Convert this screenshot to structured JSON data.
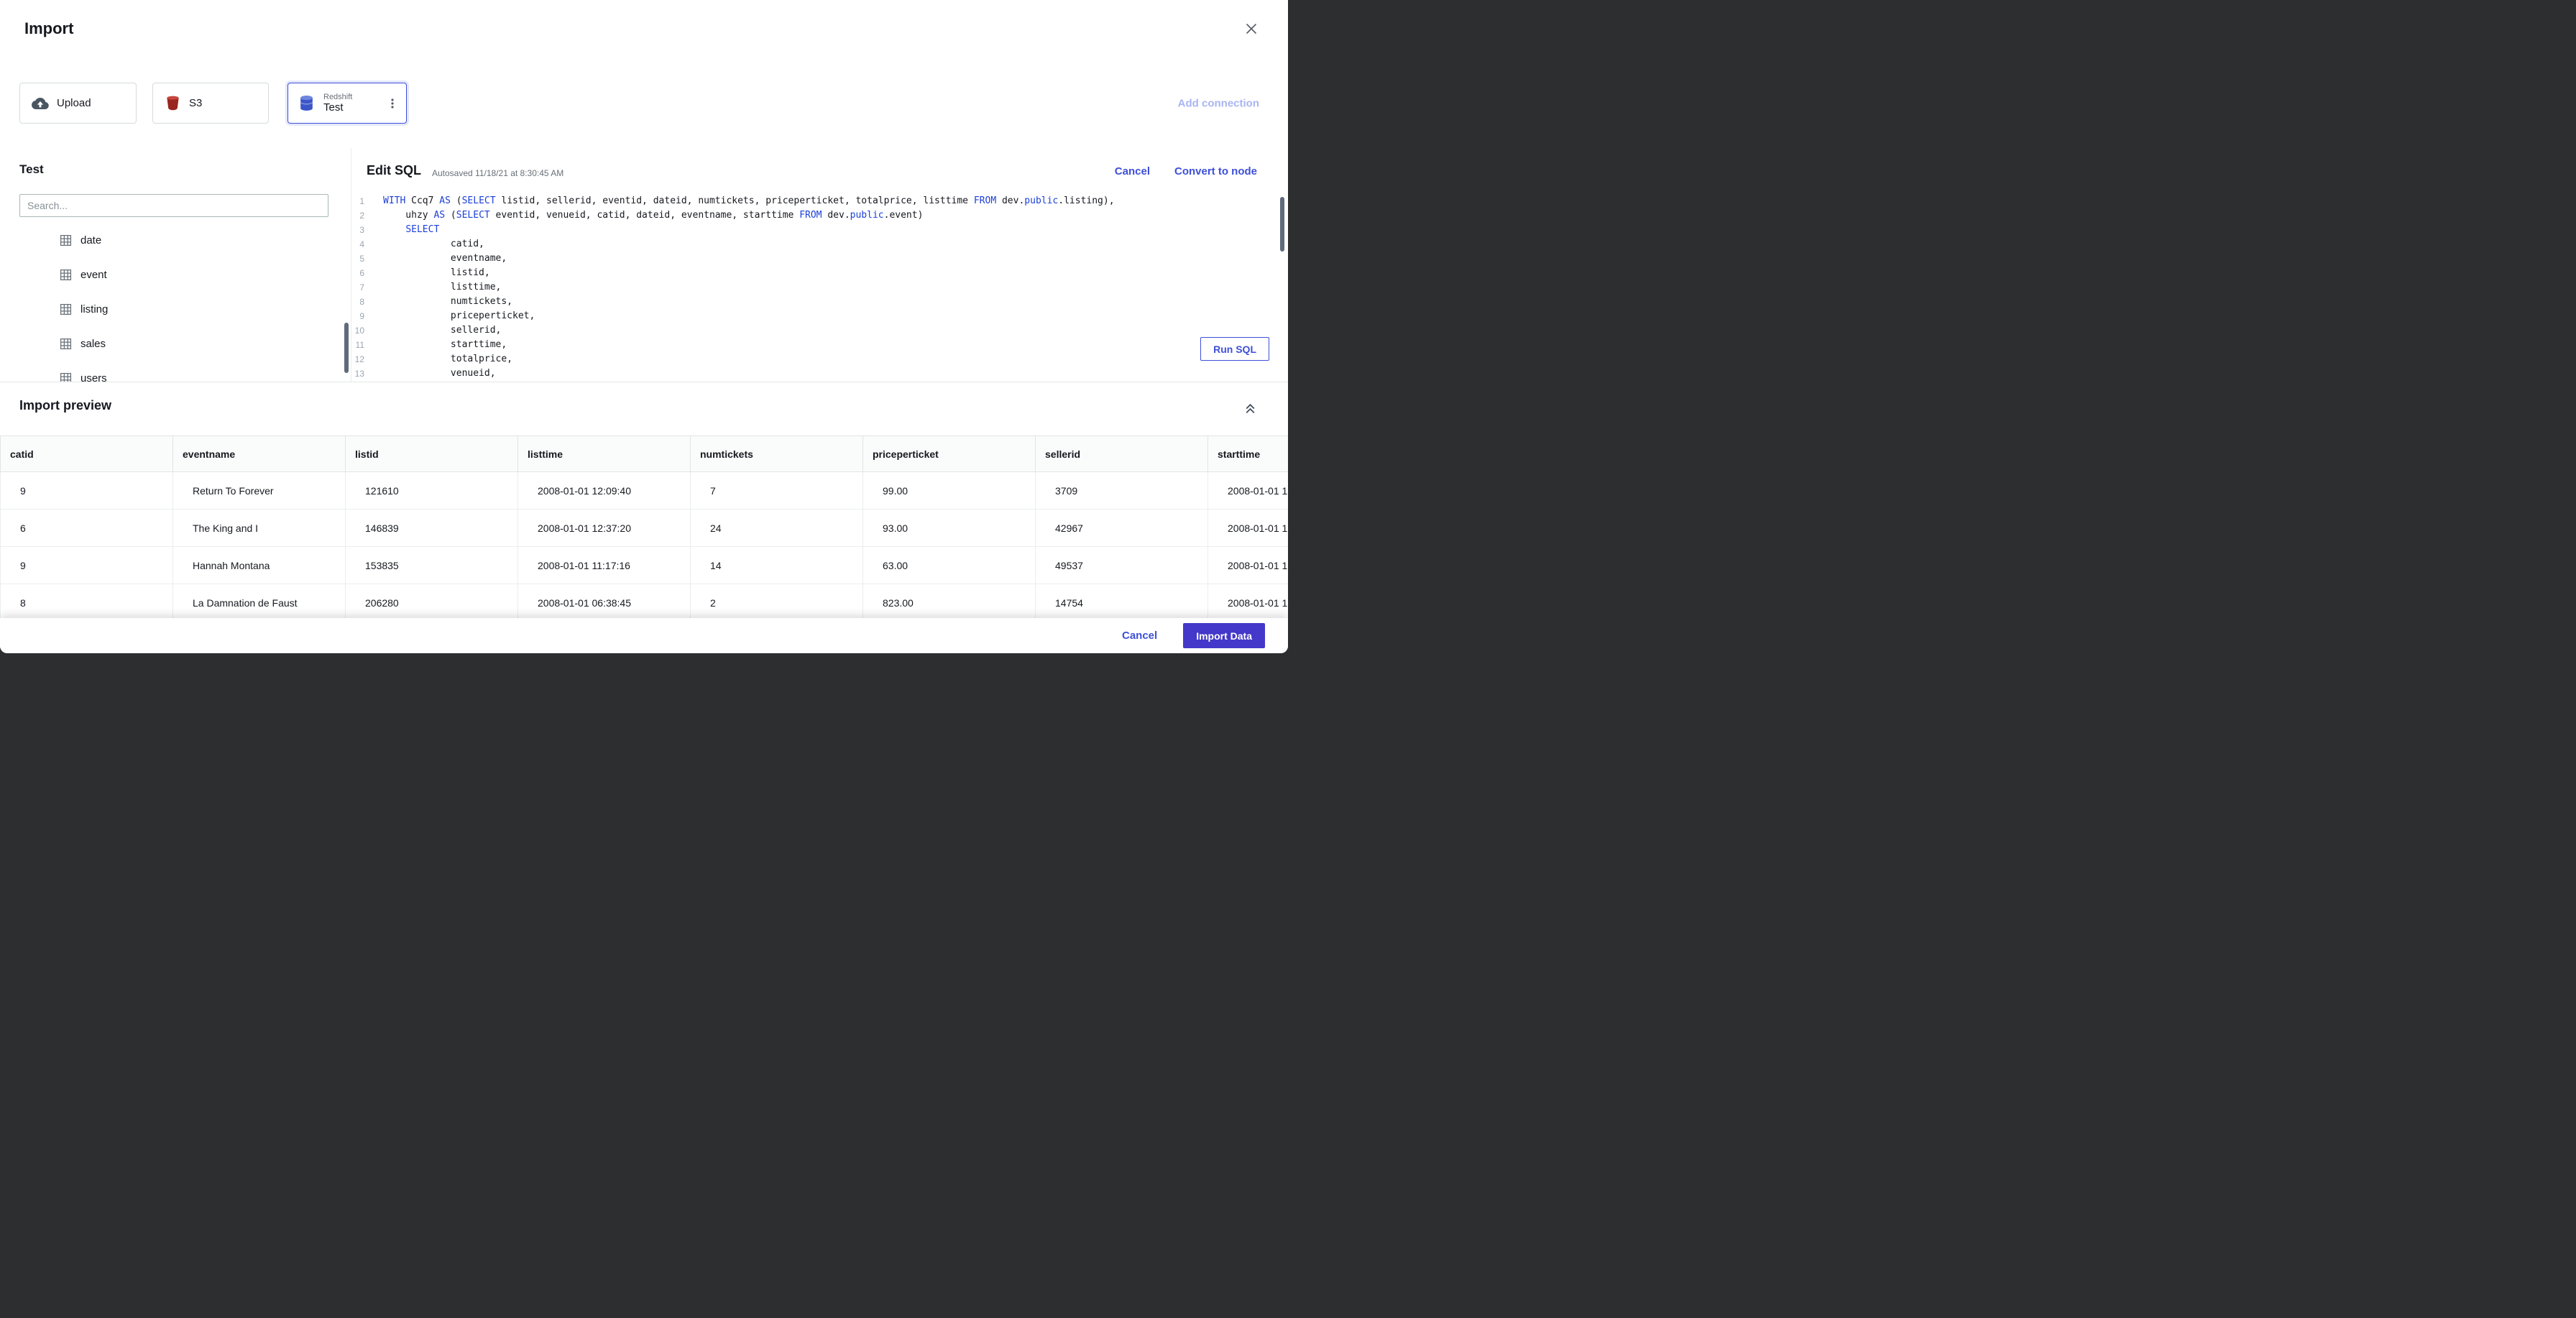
{
  "colors": {
    "accent": "#3e4fd8",
    "accent_muted": "#a9b5f2",
    "primary_button_bg": "#4338ca",
    "sql_keyword": "#1c3fd8"
  },
  "header": {
    "title": "Import"
  },
  "connections": {
    "add_label": "Add connection",
    "cards": [
      {
        "label": "Upload"
      },
      {
        "label": "S3"
      },
      {
        "type": "Redshift",
        "name": "Test",
        "selected": true
      }
    ]
  },
  "sidebar": {
    "schema_title": "Test",
    "search_placeholder": "Search...",
    "tables": [
      "date",
      "event",
      "listing",
      "sales",
      "users"
    ]
  },
  "sql_editor": {
    "title": "Edit SQL",
    "autosaved": "Autosaved 11/18/21 at 8:30:45 AM",
    "cancel_label": "Cancel",
    "convert_label": "Convert to node",
    "run_label": "Run SQL",
    "lines": [
      [
        [
          "k",
          "WITH"
        ],
        [
          "t",
          " Ccq7 "
        ],
        [
          "k",
          "AS"
        ],
        [
          "t",
          " ("
        ],
        [
          "k",
          "SELECT"
        ],
        [
          "t",
          " listid, sellerid, eventid, dateid, numtickets, priceperticket, totalprice, listtime "
        ],
        [
          "k",
          "FROM"
        ],
        [
          "t",
          " dev."
        ],
        [
          "k",
          "public"
        ],
        [
          "t",
          ".listing),"
        ]
      ],
      [
        [
          "t",
          "    uhzy "
        ],
        [
          "k",
          "AS"
        ],
        [
          "t",
          " ("
        ],
        [
          "k",
          "SELECT"
        ],
        [
          "t",
          " eventid, venueid, catid, dateid, eventname, starttime "
        ],
        [
          "k",
          "FROM"
        ],
        [
          "t",
          " dev."
        ],
        [
          "k",
          "public"
        ],
        [
          "t",
          ".event)"
        ]
      ],
      [
        [
          "t",
          "    "
        ],
        [
          "k",
          "SELECT"
        ]
      ],
      [
        [
          "t",
          "            catid,"
        ]
      ],
      [
        [
          "t",
          "            eventname,"
        ]
      ],
      [
        [
          "t",
          "            listid,"
        ]
      ],
      [
        [
          "t",
          "            listtime,"
        ]
      ],
      [
        [
          "t",
          "            numtickets,"
        ]
      ],
      [
        [
          "t",
          "            priceperticket,"
        ]
      ],
      [
        [
          "t",
          "            sellerid,"
        ]
      ],
      [
        [
          "t",
          "            starttime,"
        ]
      ],
      [
        [
          "t",
          "            totalprice,"
        ]
      ],
      [
        [
          "t",
          "            venueid,"
        ]
      ]
    ]
  },
  "preview": {
    "title": "Import preview",
    "columns": [
      "catid",
      "eventname",
      "listid",
      "listtime",
      "numtickets",
      "priceperticket",
      "sellerid",
      "starttime"
    ],
    "rows": [
      [
        "9",
        "Return To Forever",
        "121610",
        "2008-01-01 12:09:40",
        "7",
        "99.00",
        "3709",
        "2008-01-01 1"
      ],
      [
        "6",
        "The King and I",
        "146839",
        "2008-01-01 12:37:20",
        "24",
        "93.00",
        "42967",
        "2008-01-01 1"
      ],
      [
        "9",
        "Hannah Montana",
        "153835",
        "2008-01-01 11:17:16",
        "14",
        "63.00",
        "49537",
        "2008-01-01 1"
      ],
      [
        "8",
        "La Damnation de Faust",
        "206280",
        "2008-01-01 06:38:45",
        "2",
        "823.00",
        "14754",
        "2008-01-01 1"
      ]
    ]
  },
  "footer": {
    "cancel_label": "Cancel",
    "import_label": "Import Data"
  }
}
